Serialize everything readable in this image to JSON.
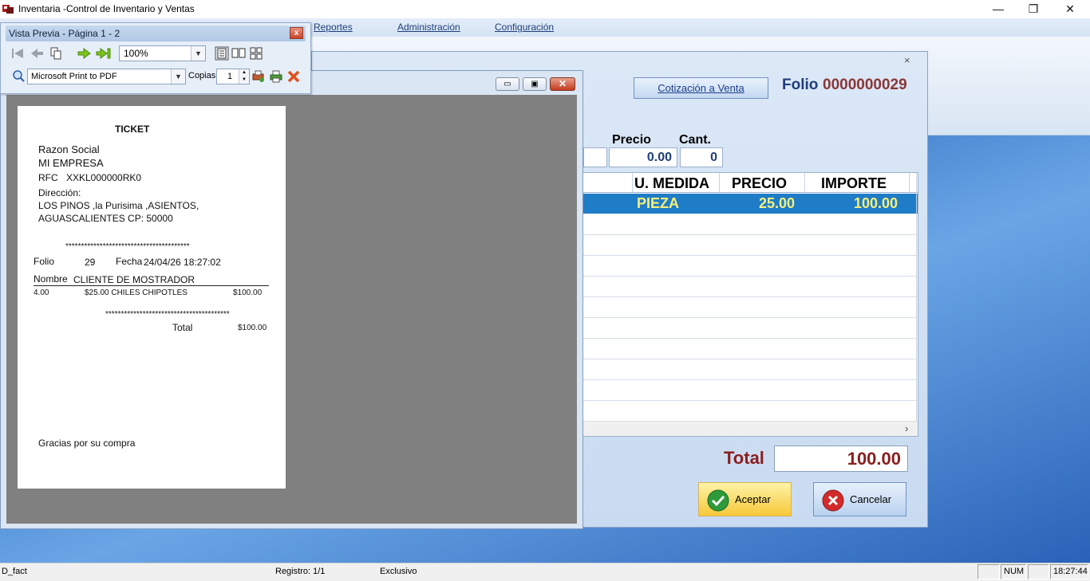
{
  "app": {
    "title": "Inventaria -Control de Inventario y Ventas"
  },
  "window_controls": {
    "minimize": "—",
    "maximize": "❐",
    "close": "✕"
  },
  "menu": {
    "items": [
      "Reportes",
      "Administración",
      "Configuración"
    ]
  },
  "status_bar": {
    "left": "D_fact",
    "registro": "Registro: 1/1",
    "mode": "Exclusivo",
    "num": "NUM",
    "time": "18:27:44"
  },
  "sales": {
    "close": "×",
    "cotizacion_button": "Cotización a Venta",
    "folio_label": "Folio",
    "folio_value": "0000000029",
    "precio_label": "Precio",
    "precio_value": "0.00",
    "cant_label": "Cant.",
    "cant_value": "0",
    "grid": {
      "headers": [
        "U. MEDIDA",
        "PRECIO",
        "IMPORTE"
      ],
      "rows": [
        {
          "unidad": "PIEZA",
          "precio": "25.00",
          "importe": "100.00"
        }
      ],
      "scroll_arrow": "›"
    },
    "total_label": "Total",
    "total_value": "100.00",
    "accept_button": "Aceptar",
    "cancel_button": "Cancelar"
  },
  "preview_window": {
    "minimize": "▭",
    "maximize": "▣",
    "close": "✕"
  },
  "vista_previa": {
    "title": "Vista Previa - Página 1 - 2",
    "close": "x",
    "zoom": "100%",
    "printer": "Microsoft Print to PDF",
    "copias_label": "Copias",
    "copias_value": "1"
  },
  "ticket": {
    "heading": "TICKET",
    "razon_social_label": "Razon Social",
    "empresa": "MI EMPRESA",
    "rfc_label": "RFC",
    "rfc_value": "XXKL000000RK0",
    "direccion_label": "Dirección:",
    "direccion_line1": "LOS PINOS ,la Purisima ,ASIENTOS,",
    "direccion_line2": "AGUASCALIENTES CP: 50000",
    "stars": "****************************************",
    "folio_label": "Folio",
    "folio_value": "29",
    "fecha_label": "Fecha",
    "fecha_value": "24/04/26 18:27:02",
    "nombre_label": "Nombre",
    "nombre_value": "CLIENTE DE MOSTRADOR",
    "item_qty": "4.00",
    "item_desc": "$25.00 CHILES CHIPOTLES",
    "item_total": "$100.00",
    "total_label": "Total",
    "total_value": "$100.00",
    "footer": "Gracias por su compra"
  },
  "colors": {
    "folio_blue": "#1f3e7a",
    "folio_red": "#8a3636",
    "selected_row": "#1f7cc7",
    "selected_text": "#f7f07a",
    "total_red": "#8a1e1e"
  }
}
